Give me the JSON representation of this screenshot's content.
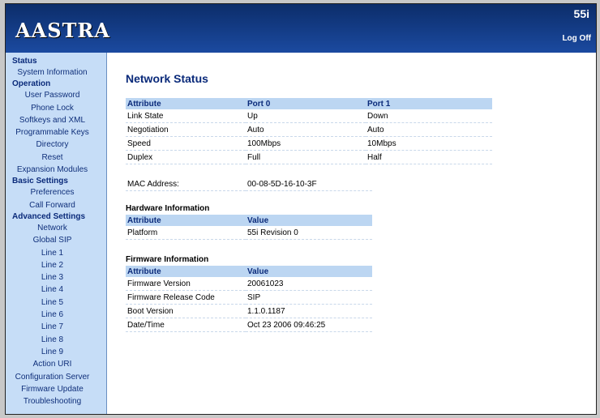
{
  "header": {
    "logo": "AASTRA",
    "model": "55i",
    "logoff": "Log Off"
  },
  "sidebar": {
    "sections": [
      {
        "title": "Status",
        "items": [
          "System Information"
        ]
      },
      {
        "title": "Operation",
        "items": [
          "User Password",
          "Phone Lock",
          "Softkeys and XML",
          "Programmable Keys",
          "Directory",
          "Reset",
          "Expansion Modules"
        ]
      },
      {
        "title": "Basic Settings",
        "items": [
          "Preferences",
          "Call Forward"
        ]
      },
      {
        "title": "Advanced Settings",
        "items": [
          "Network",
          "Global SIP",
          "Line 1",
          "Line 2",
          "Line 3",
          "Line 4",
          "Line 5",
          "Line 6",
          "Line 7",
          "Line 8",
          "Line 9",
          "Action URI",
          "Configuration Server",
          "Firmware Update",
          "Troubleshooting"
        ]
      }
    ]
  },
  "main": {
    "title": "Network Status",
    "network": {
      "headers": [
        "Attribute",
        "Port 0",
        "Port 1"
      ],
      "rows": [
        [
          "Link State",
          "Up",
          "Down"
        ],
        [
          "Negotiation",
          "Auto",
          "Auto"
        ],
        [
          "Speed",
          "100Mbps",
          "10Mbps"
        ],
        [
          "Duplex",
          "Full",
          "Half"
        ]
      ],
      "mac_label": "MAC Address:",
      "mac_value": "00-08-5D-16-10-3F"
    },
    "hardware": {
      "title": "Hardware Information",
      "headers": [
        "Attribute",
        "Value"
      ],
      "rows": [
        [
          "Platform",
          "55i Revision 0"
        ]
      ]
    },
    "firmware": {
      "title": "Firmware Information",
      "headers": [
        "Attribute",
        "Value"
      ],
      "rows": [
        [
          "Firmware Version",
          "20061023"
        ],
        [
          "Firmware Release Code",
          "SIP"
        ],
        [
          "Boot Version",
          "1.1.0.1187"
        ],
        [
          "Date/Time",
          "Oct 23 2006 09:46:25"
        ]
      ]
    }
  }
}
